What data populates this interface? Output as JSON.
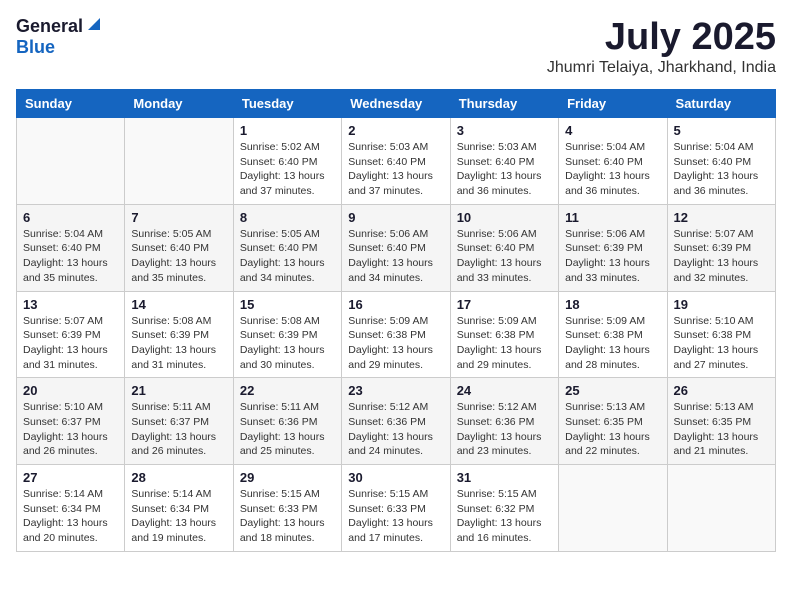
{
  "header": {
    "logo_general": "General",
    "logo_blue": "Blue",
    "month": "July 2025",
    "location": "Jhumri Telaiya, Jharkhand, India"
  },
  "weekdays": [
    "Sunday",
    "Monday",
    "Tuesday",
    "Wednesday",
    "Thursday",
    "Friday",
    "Saturday"
  ],
  "weeks": [
    [
      {
        "day": "",
        "info": ""
      },
      {
        "day": "",
        "info": ""
      },
      {
        "day": "1",
        "info": "Sunrise: 5:02 AM\nSunset: 6:40 PM\nDaylight: 13 hours and 37 minutes."
      },
      {
        "day": "2",
        "info": "Sunrise: 5:03 AM\nSunset: 6:40 PM\nDaylight: 13 hours and 37 minutes."
      },
      {
        "day": "3",
        "info": "Sunrise: 5:03 AM\nSunset: 6:40 PM\nDaylight: 13 hours and 36 minutes."
      },
      {
        "day": "4",
        "info": "Sunrise: 5:04 AM\nSunset: 6:40 PM\nDaylight: 13 hours and 36 minutes."
      },
      {
        "day": "5",
        "info": "Sunrise: 5:04 AM\nSunset: 6:40 PM\nDaylight: 13 hours and 36 minutes."
      }
    ],
    [
      {
        "day": "6",
        "info": "Sunrise: 5:04 AM\nSunset: 6:40 PM\nDaylight: 13 hours and 35 minutes."
      },
      {
        "day": "7",
        "info": "Sunrise: 5:05 AM\nSunset: 6:40 PM\nDaylight: 13 hours and 35 minutes."
      },
      {
        "day": "8",
        "info": "Sunrise: 5:05 AM\nSunset: 6:40 PM\nDaylight: 13 hours and 34 minutes."
      },
      {
        "day": "9",
        "info": "Sunrise: 5:06 AM\nSunset: 6:40 PM\nDaylight: 13 hours and 34 minutes."
      },
      {
        "day": "10",
        "info": "Sunrise: 5:06 AM\nSunset: 6:40 PM\nDaylight: 13 hours and 33 minutes."
      },
      {
        "day": "11",
        "info": "Sunrise: 5:06 AM\nSunset: 6:39 PM\nDaylight: 13 hours and 33 minutes."
      },
      {
        "day": "12",
        "info": "Sunrise: 5:07 AM\nSunset: 6:39 PM\nDaylight: 13 hours and 32 minutes."
      }
    ],
    [
      {
        "day": "13",
        "info": "Sunrise: 5:07 AM\nSunset: 6:39 PM\nDaylight: 13 hours and 31 minutes."
      },
      {
        "day": "14",
        "info": "Sunrise: 5:08 AM\nSunset: 6:39 PM\nDaylight: 13 hours and 31 minutes."
      },
      {
        "day": "15",
        "info": "Sunrise: 5:08 AM\nSunset: 6:39 PM\nDaylight: 13 hours and 30 minutes."
      },
      {
        "day": "16",
        "info": "Sunrise: 5:09 AM\nSunset: 6:38 PM\nDaylight: 13 hours and 29 minutes."
      },
      {
        "day": "17",
        "info": "Sunrise: 5:09 AM\nSunset: 6:38 PM\nDaylight: 13 hours and 29 minutes."
      },
      {
        "day": "18",
        "info": "Sunrise: 5:09 AM\nSunset: 6:38 PM\nDaylight: 13 hours and 28 minutes."
      },
      {
        "day": "19",
        "info": "Sunrise: 5:10 AM\nSunset: 6:38 PM\nDaylight: 13 hours and 27 minutes."
      }
    ],
    [
      {
        "day": "20",
        "info": "Sunrise: 5:10 AM\nSunset: 6:37 PM\nDaylight: 13 hours and 26 minutes."
      },
      {
        "day": "21",
        "info": "Sunrise: 5:11 AM\nSunset: 6:37 PM\nDaylight: 13 hours and 26 minutes."
      },
      {
        "day": "22",
        "info": "Sunrise: 5:11 AM\nSunset: 6:36 PM\nDaylight: 13 hours and 25 minutes."
      },
      {
        "day": "23",
        "info": "Sunrise: 5:12 AM\nSunset: 6:36 PM\nDaylight: 13 hours and 24 minutes."
      },
      {
        "day": "24",
        "info": "Sunrise: 5:12 AM\nSunset: 6:36 PM\nDaylight: 13 hours and 23 minutes."
      },
      {
        "day": "25",
        "info": "Sunrise: 5:13 AM\nSunset: 6:35 PM\nDaylight: 13 hours and 22 minutes."
      },
      {
        "day": "26",
        "info": "Sunrise: 5:13 AM\nSunset: 6:35 PM\nDaylight: 13 hours and 21 minutes."
      }
    ],
    [
      {
        "day": "27",
        "info": "Sunrise: 5:14 AM\nSunset: 6:34 PM\nDaylight: 13 hours and 20 minutes."
      },
      {
        "day": "28",
        "info": "Sunrise: 5:14 AM\nSunset: 6:34 PM\nDaylight: 13 hours and 19 minutes."
      },
      {
        "day": "29",
        "info": "Sunrise: 5:15 AM\nSunset: 6:33 PM\nDaylight: 13 hours and 18 minutes."
      },
      {
        "day": "30",
        "info": "Sunrise: 5:15 AM\nSunset: 6:33 PM\nDaylight: 13 hours and 17 minutes."
      },
      {
        "day": "31",
        "info": "Sunrise: 5:15 AM\nSunset: 6:32 PM\nDaylight: 13 hours and 16 minutes."
      },
      {
        "day": "",
        "info": ""
      },
      {
        "day": "",
        "info": ""
      }
    ]
  ]
}
